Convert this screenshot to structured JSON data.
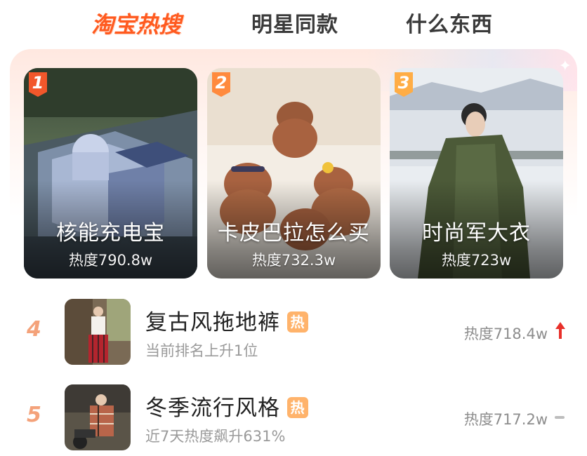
{
  "tabs": [
    {
      "label": "淘宝热搜",
      "active": true
    },
    {
      "label": "明星同款",
      "active": false
    },
    {
      "label": "什么东西",
      "active": false
    }
  ],
  "top_cards": [
    {
      "rank": "1",
      "title": "核能充电宝",
      "heat": "热度790.8w",
      "image": "nuclear-plant-rendering"
    },
    {
      "rank": "2",
      "title": "卡皮巴拉怎么买",
      "heat": "热度732.3w",
      "image": "capybara-plush-toys"
    },
    {
      "rank": "3",
      "title": "时尚军大衣",
      "heat": "热度723w",
      "image": "woman-green-army-coat-snow"
    }
  ],
  "list": [
    {
      "rank": "4",
      "title": "复古风拖地裤",
      "tag": "热",
      "subtitle": "当前排名上升1位",
      "heat": "热度718.4w",
      "trend": "up-arrow-icon",
      "image": "person-red-plaid-pants"
    },
    {
      "rank": "5",
      "title": "冬季流行风格",
      "tag": "热",
      "subtitle": "近7天热度飙升631%",
      "heat": "热度717.2w",
      "trend": "flat-dash-icon",
      "image": "person-plaid-coat-scooter"
    }
  ],
  "colors": {
    "accent": "#ff5a1f",
    "rank1": "#f2572b",
    "rank2": "#ff8a3d",
    "rank3": "#ffad45",
    "list_rank": "#f4a27a",
    "hot_tag": "#ffb36b",
    "trend_up": "#e8302a"
  }
}
